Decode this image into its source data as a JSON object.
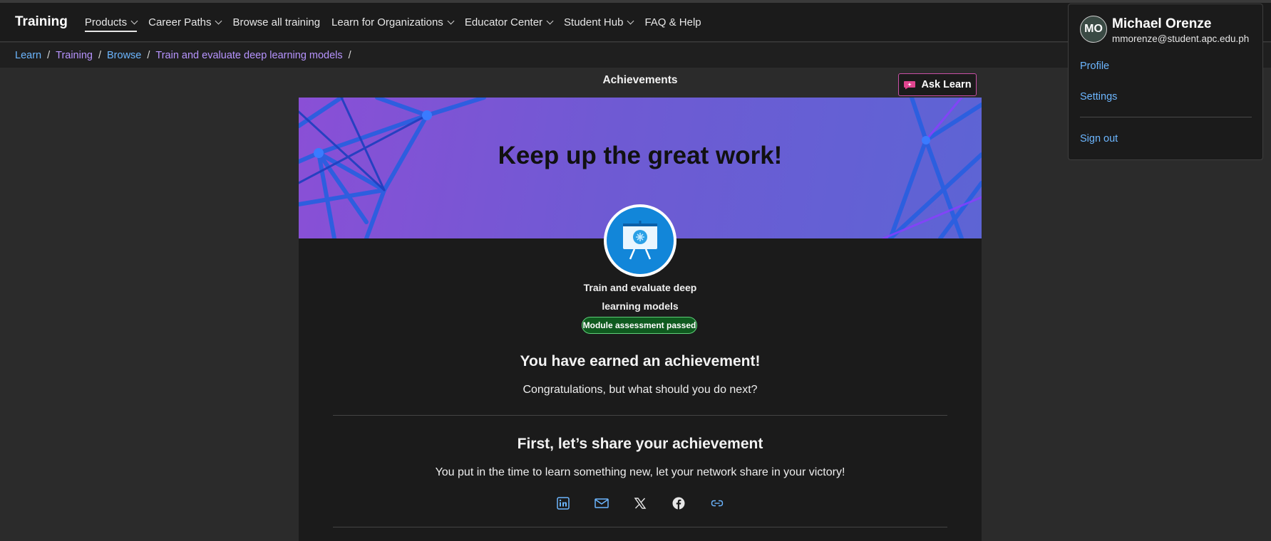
{
  "nav": {
    "brand": "Training",
    "items": [
      {
        "label": "Products",
        "dropdown": true,
        "active": true
      },
      {
        "label": "Career Paths",
        "dropdown": true
      },
      {
        "label": "Browse all training",
        "dropdown": false
      },
      {
        "label": "Learn for Organizations",
        "dropdown": true
      },
      {
        "label": "Educator Center",
        "dropdown": true
      },
      {
        "label": "Student Hub",
        "dropdown": true
      },
      {
        "label": "FAQ & Help",
        "dropdown": false
      }
    ]
  },
  "breadcrumb": {
    "items": [
      "Learn",
      "Training",
      "Browse",
      "Train and evaluate deep learning models"
    ],
    "separator": "/"
  },
  "page": {
    "title": "Achievements",
    "ask_learn": "Ask Learn",
    "banner_title": "Keep up the great work!",
    "module_line1": "Train and evaluate deep",
    "module_line2": "learning models",
    "status_pill": "Module assessment passed",
    "earned_heading": "You have earned an achievement!",
    "congrats_text": "Congratulations, but what should you do next?",
    "share_heading": "First, let’s share your achievement",
    "share_text": "You put in the time to learn something new, let your network share in your victory!",
    "share_icons": [
      "linkedin-icon",
      "mail-icon",
      "x-icon",
      "facebook-icon",
      "link-icon"
    ]
  },
  "profile": {
    "initials": "MO",
    "name": "Michael Orenze",
    "email": "mmorenze@student.apc.edu.ph",
    "links": [
      "Profile",
      "Settings",
      "Sign out"
    ]
  },
  "colors": {
    "link_blue": "#6cb6ff",
    "link_purple": "#b794ff",
    "banner_start": "#8a4fd6",
    "banner_end": "#5d64d4",
    "pass_green": "#0f5a1f",
    "ask_learn_border": "#c84fa5"
  }
}
